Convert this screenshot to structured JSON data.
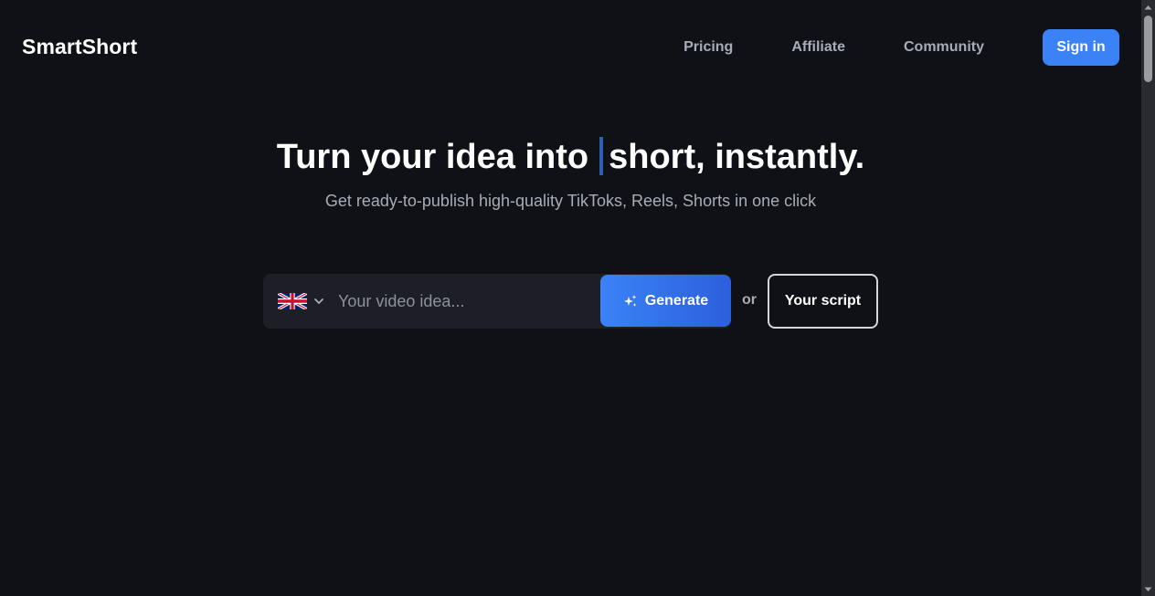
{
  "header": {
    "logo": "SmartShort",
    "nav": [
      {
        "label": "Pricing"
      },
      {
        "label": "Affiliate"
      },
      {
        "label": "Community"
      }
    ],
    "signin_label": "Sign in"
  },
  "hero": {
    "title_prefix": "Turn your idea into",
    "title_suffix": "short, instantly.",
    "subtitle": "Get ready-to-publish high-quality TikToks, Reels, Shorts in one click"
  },
  "generator": {
    "language_flag": "uk-flag-icon",
    "placeholder": "Your video idea...",
    "generate_label": "Generate",
    "or_text": "or",
    "script_label": "Your script"
  },
  "colors": {
    "background": "#101116",
    "accent": "#3b82f6",
    "muted_text": "#a7acb6",
    "input_bg": "#1e1f26"
  }
}
